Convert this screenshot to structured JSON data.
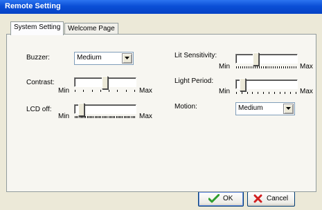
{
  "window": {
    "title": "Remote Setting"
  },
  "tabs": [
    {
      "label": "System Setting",
      "active": true
    },
    {
      "label": "Welcome Page",
      "active": false
    }
  ],
  "settings": {
    "buzzer": {
      "label": "Buzzer:",
      "value": "Medium"
    },
    "contrast": {
      "label": "Contrast:",
      "min": "Min",
      "max": "Max",
      "level": 0.5
    },
    "lcd_off": {
      "label": "LCD off:",
      "min": "Min",
      "max": "Max",
      "level": 0.05
    },
    "lit_sensitivity": {
      "label": "Lit Sensitivity:",
      "min": "Min",
      "max": "Max",
      "level": 0.3
    },
    "light_period": {
      "label": "Light Period:",
      "min": "Min",
      "max": "Max",
      "level": 0.05
    },
    "motion": {
      "label": "Motion:",
      "value": "Medium"
    }
  },
  "buttons": {
    "ok": "OK",
    "cancel": "Cancel"
  },
  "icons": {
    "ok": "checkmark-icon",
    "cancel": "red-x-icon",
    "dropdown": "chevron-down-icon"
  },
  "colors": {
    "titlebar": "#0a4fd6",
    "ok_check": "#2e9e2e",
    "cancel_x": "#d21f1f"
  }
}
